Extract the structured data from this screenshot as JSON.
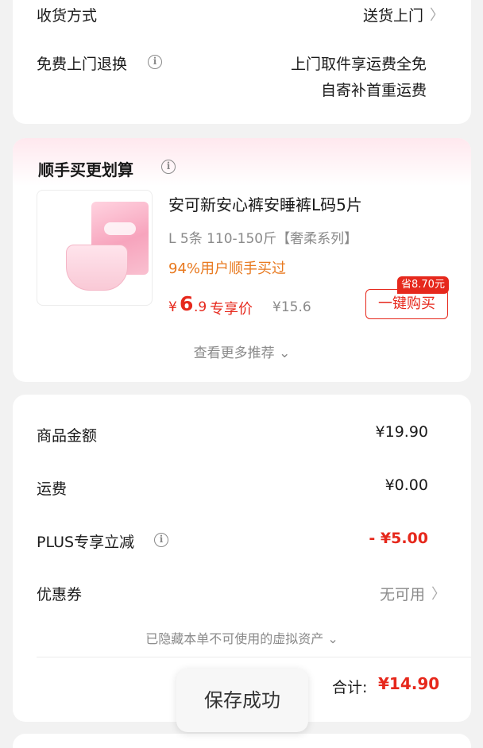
{
  "shipping": {
    "method_label": "收货方式",
    "method_value": "送货上门",
    "return_label": "免费上门退换",
    "return_value_line1": "上门取件享运费全免",
    "return_value_line2": "自寄补首重运费"
  },
  "recommend": {
    "section_title": "顺手买更划算",
    "product": {
      "title": "安可新安心裤安睡裤L码5片",
      "spec": "L 5条 110-150斤【奢柔系列】",
      "social_proof": "94%用户顺手买过",
      "price_symbol": "¥",
      "price_int": "6",
      "price_dec": ".9",
      "price_tag": "专享价",
      "original_price": "¥15.6",
      "save_badge": "省8.70元",
      "buy_button": "一键购买"
    },
    "more_link": "查看更多推荐 ⌄"
  },
  "summary": {
    "goods_label": "商品金额",
    "goods_value": "¥19.90",
    "shipping_label": "运费",
    "shipping_value": "¥0.00",
    "plus_label": "PLUS专享立减",
    "plus_value": "- ¥5.00",
    "coupon_label": "优惠券",
    "coupon_value": "无可用",
    "hidden_assets": "已隐藏本单不可使用的虚拟资产 ⌄",
    "total_label": "合计:",
    "total_value": "¥14.90"
  },
  "toast": {
    "message": "保存成功"
  },
  "icons": {
    "chevron": "chevron-right-icon",
    "info": "info-icon"
  },
  "colors": {
    "accent_red": "#e6281c",
    "orange": "#e8791f",
    "muted_gray": "#8a8a8a"
  }
}
